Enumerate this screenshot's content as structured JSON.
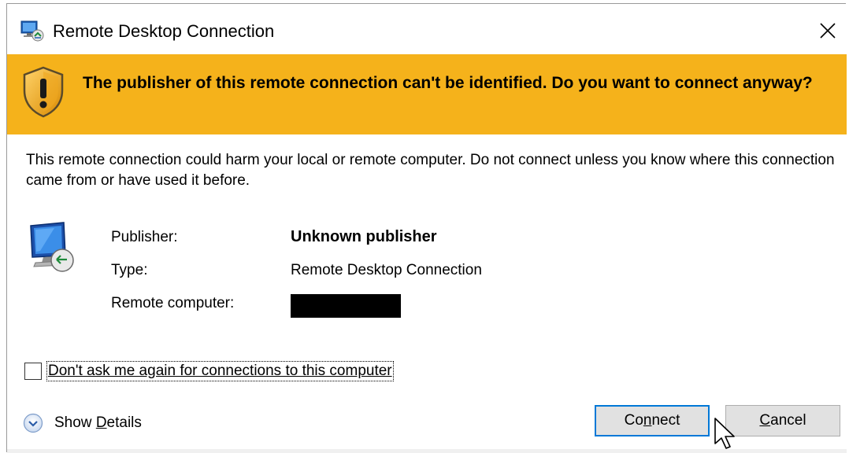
{
  "window": {
    "title": "Remote Desktop Connection",
    "close_label": "Close"
  },
  "banner": {
    "message": "The publisher of this remote connection can't be identified. Do you want to connect anyway?",
    "background_color": "#f5b21b"
  },
  "warning": {
    "text": "This remote connection could harm your local or remote computer. Do not connect unless you know where this connection came from or have used it before."
  },
  "details": {
    "publisher_label": "Publisher:",
    "publisher_value": "Unknown publisher",
    "type_label": "Type:",
    "type_value": "Remote Desktop Connection",
    "remote_computer_label": "Remote computer:",
    "remote_computer_value_redacted": true
  },
  "checkbox": {
    "label": "Don't ask me again for connections to this computer",
    "checked": false
  },
  "show_details": {
    "prefix": "Show ",
    "mnemonic": "D",
    "suffix": "etails"
  },
  "buttons": {
    "connect_prefix": "Co",
    "connect_mnemonic": "n",
    "connect_suffix": "nect",
    "cancel_mnemonic": "C",
    "cancel_suffix": "ancel"
  },
  "colors": {
    "accent": "#0078d7",
    "banner": "#f5b21b"
  },
  "icons": {
    "app": "remote-desktop-icon",
    "banner": "warning-shield-icon",
    "details": "remote-desktop-computer-icon",
    "show_details": "chevron-down-circle-icon",
    "close": "close-icon"
  }
}
